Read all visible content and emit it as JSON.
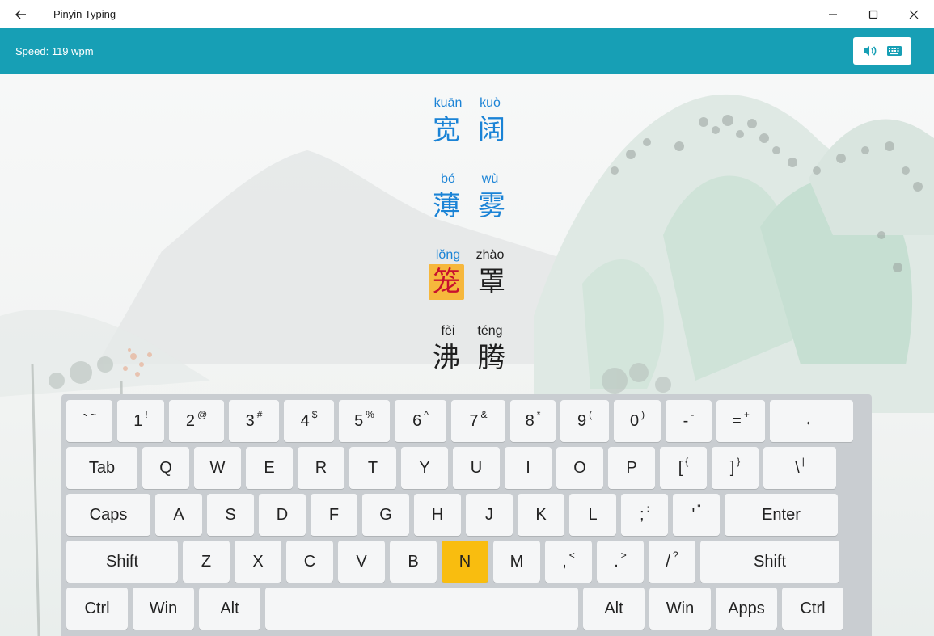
{
  "window": {
    "title": "Pinyin Typing",
    "back_icon": "arrow-left-icon",
    "minimize_icon": "minimize-icon",
    "maximize_icon": "maximize-icon",
    "close_icon": "close-icon"
  },
  "toolbar": {
    "speed_text": "Speed: 119 wpm",
    "sound_icon": "speaker-icon",
    "keyboard_icon": "keyboard-icon",
    "bg_color": "#179fb5"
  },
  "words": [
    {
      "pinyin": [
        "kuān",
        "kuò"
      ],
      "hanzi": [
        "宽",
        "阔"
      ],
      "state": "done"
    },
    {
      "pinyin": [
        "bó",
        "wù"
      ],
      "hanzi": [
        "薄",
        "雾"
      ],
      "state": "done"
    },
    {
      "pinyin": [
        "lǒng",
        "zhào"
      ],
      "hanzi": [
        "笼",
        "罩"
      ],
      "state": "current"
    },
    {
      "pinyin": [
        "fèi",
        "téng"
      ],
      "hanzi": [
        "沸",
        "腾"
      ],
      "state": "todo"
    }
  ],
  "colors": {
    "done_text": "#1a83d6",
    "current_highlight": "#f6b73c",
    "current_char": "#c8102e",
    "active_key": "#f9bd0f"
  },
  "keyboard": {
    "active_key": "N",
    "rows": [
      [
        {
          "main": "`",
          "shift": "~"
        },
        {
          "main": "1",
          "shift": "!"
        },
        {
          "main": "2",
          "shift": "@"
        },
        {
          "main": "3",
          "shift": "#"
        },
        {
          "main": "4",
          "shift": "$"
        },
        {
          "main": "5",
          "shift": "%"
        },
        {
          "main": "6",
          "shift": "^"
        },
        {
          "main": "7",
          "shift": "&"
        },
        {
          "main": "8",
          "shift": "*"
        },
        {
          "main": "9",
          "shift": "("
        },
        {
          "main": "0",
          "shift": ")"
        },
        {
          "main": "-",
          "shift": "-"
        },
        {
          "main": "=",
          "shift": "+"
        },
        {
          "main": "←",
          "shift": ""
        }
      ],
      [
        {
          "main": "Tab",
          "shift": ""
        },
        {
          "main": "Q",
          "shift": ""
        },
        {
          "main": "W",
          "shift": ""
        },
        {
          "main": "E",
          "shift": ""
        },
        {
          "main": "R",
          "shift": ""
        },
        {
          "main": "T",
          "shift": ""
        },
        {
          "main": "Y",
          "shift": ""
        },
        {
          "main": "U",
          "shift": ""
        },
        {
          "main": "I",
          "shift": ""
        },
        {
          "main": "O",
          "shift": ""
        },
        {
          "main": "P",
          "shift": ""
        },
        {
          "main": "[",
          "shift": "{"
        },
        {
          "main": "]",
          "shift": "}"
        },
        {
          "main": "\\",
          "shift": "|"
        }
      ],
      [
        {
          "main": "Caps",
          "shift": ""
        },
        {
          "main": "A",
          "shift": ""
        },
        {
          "main": "S",
          "shift": ""
        },
        {
          "main": "D",
          "shift": ""
        },
        {
          "main": "F",
          "shift": ""
        },
        {
          "main": "G",
          "shift": ""
        },
        {
          "main": "H",
          "shift": ""
        },
        {
          "main": "J",
          "shift": ""
        },
        {
          "main": "K",
          "shift": ""
        },
        {
          "main": "L",
          "shift": ""
        },
        {
          "main": ";",
          "shift": ":"
        },
        {
          "main": "'",
          "shift": "\""
        },
        {
          "main": "Enter",
          "shift": ""
        }
      ],
      [
        {
          "main": "Shift",
          "shift": ""
        },
        {
          "main": "Z",
          "shift": ""
        },
        {
          "main": "X",
          "shift": ""
        },
        {
          "main": "C",
          "shift": ""
        },
        {
          "main": "V",
          "shift": ""
        },
        {
          "main": "B",
          "shift": ""
        },
        {
          "main": "N",
          "shift": ""
        },
        {
          "main": "M",
          "shift": ""
        },
        {
          "main": ",",
          "shift": "<"
        },
        {
          "main": ".",
          "shift": ">"
        },
        {
          "main": "/",
          "shift": "?"
        },
        {
          "main": "Shift",
          "shift": ""
        }
      ],
      [
        {
          "main": "Ctrl",
          "shift": ""
        },
        {
          "main": "Win",
          "shift": ""
        },
        {
          "main": "Alt",
          "shift": ""
        },
        {
          "main": "",
          "shift": ""
        },
        {
          "main": "Alt",
          "shift": ""
        },
        {
          "main": "Win",
          "shift": ""
        },
        {
          "main": "Apps",
          "shift": ""
        },
        {
          "main": "Ctrl",
          "shift": ""
        }
      ]
    ]
  }
}
